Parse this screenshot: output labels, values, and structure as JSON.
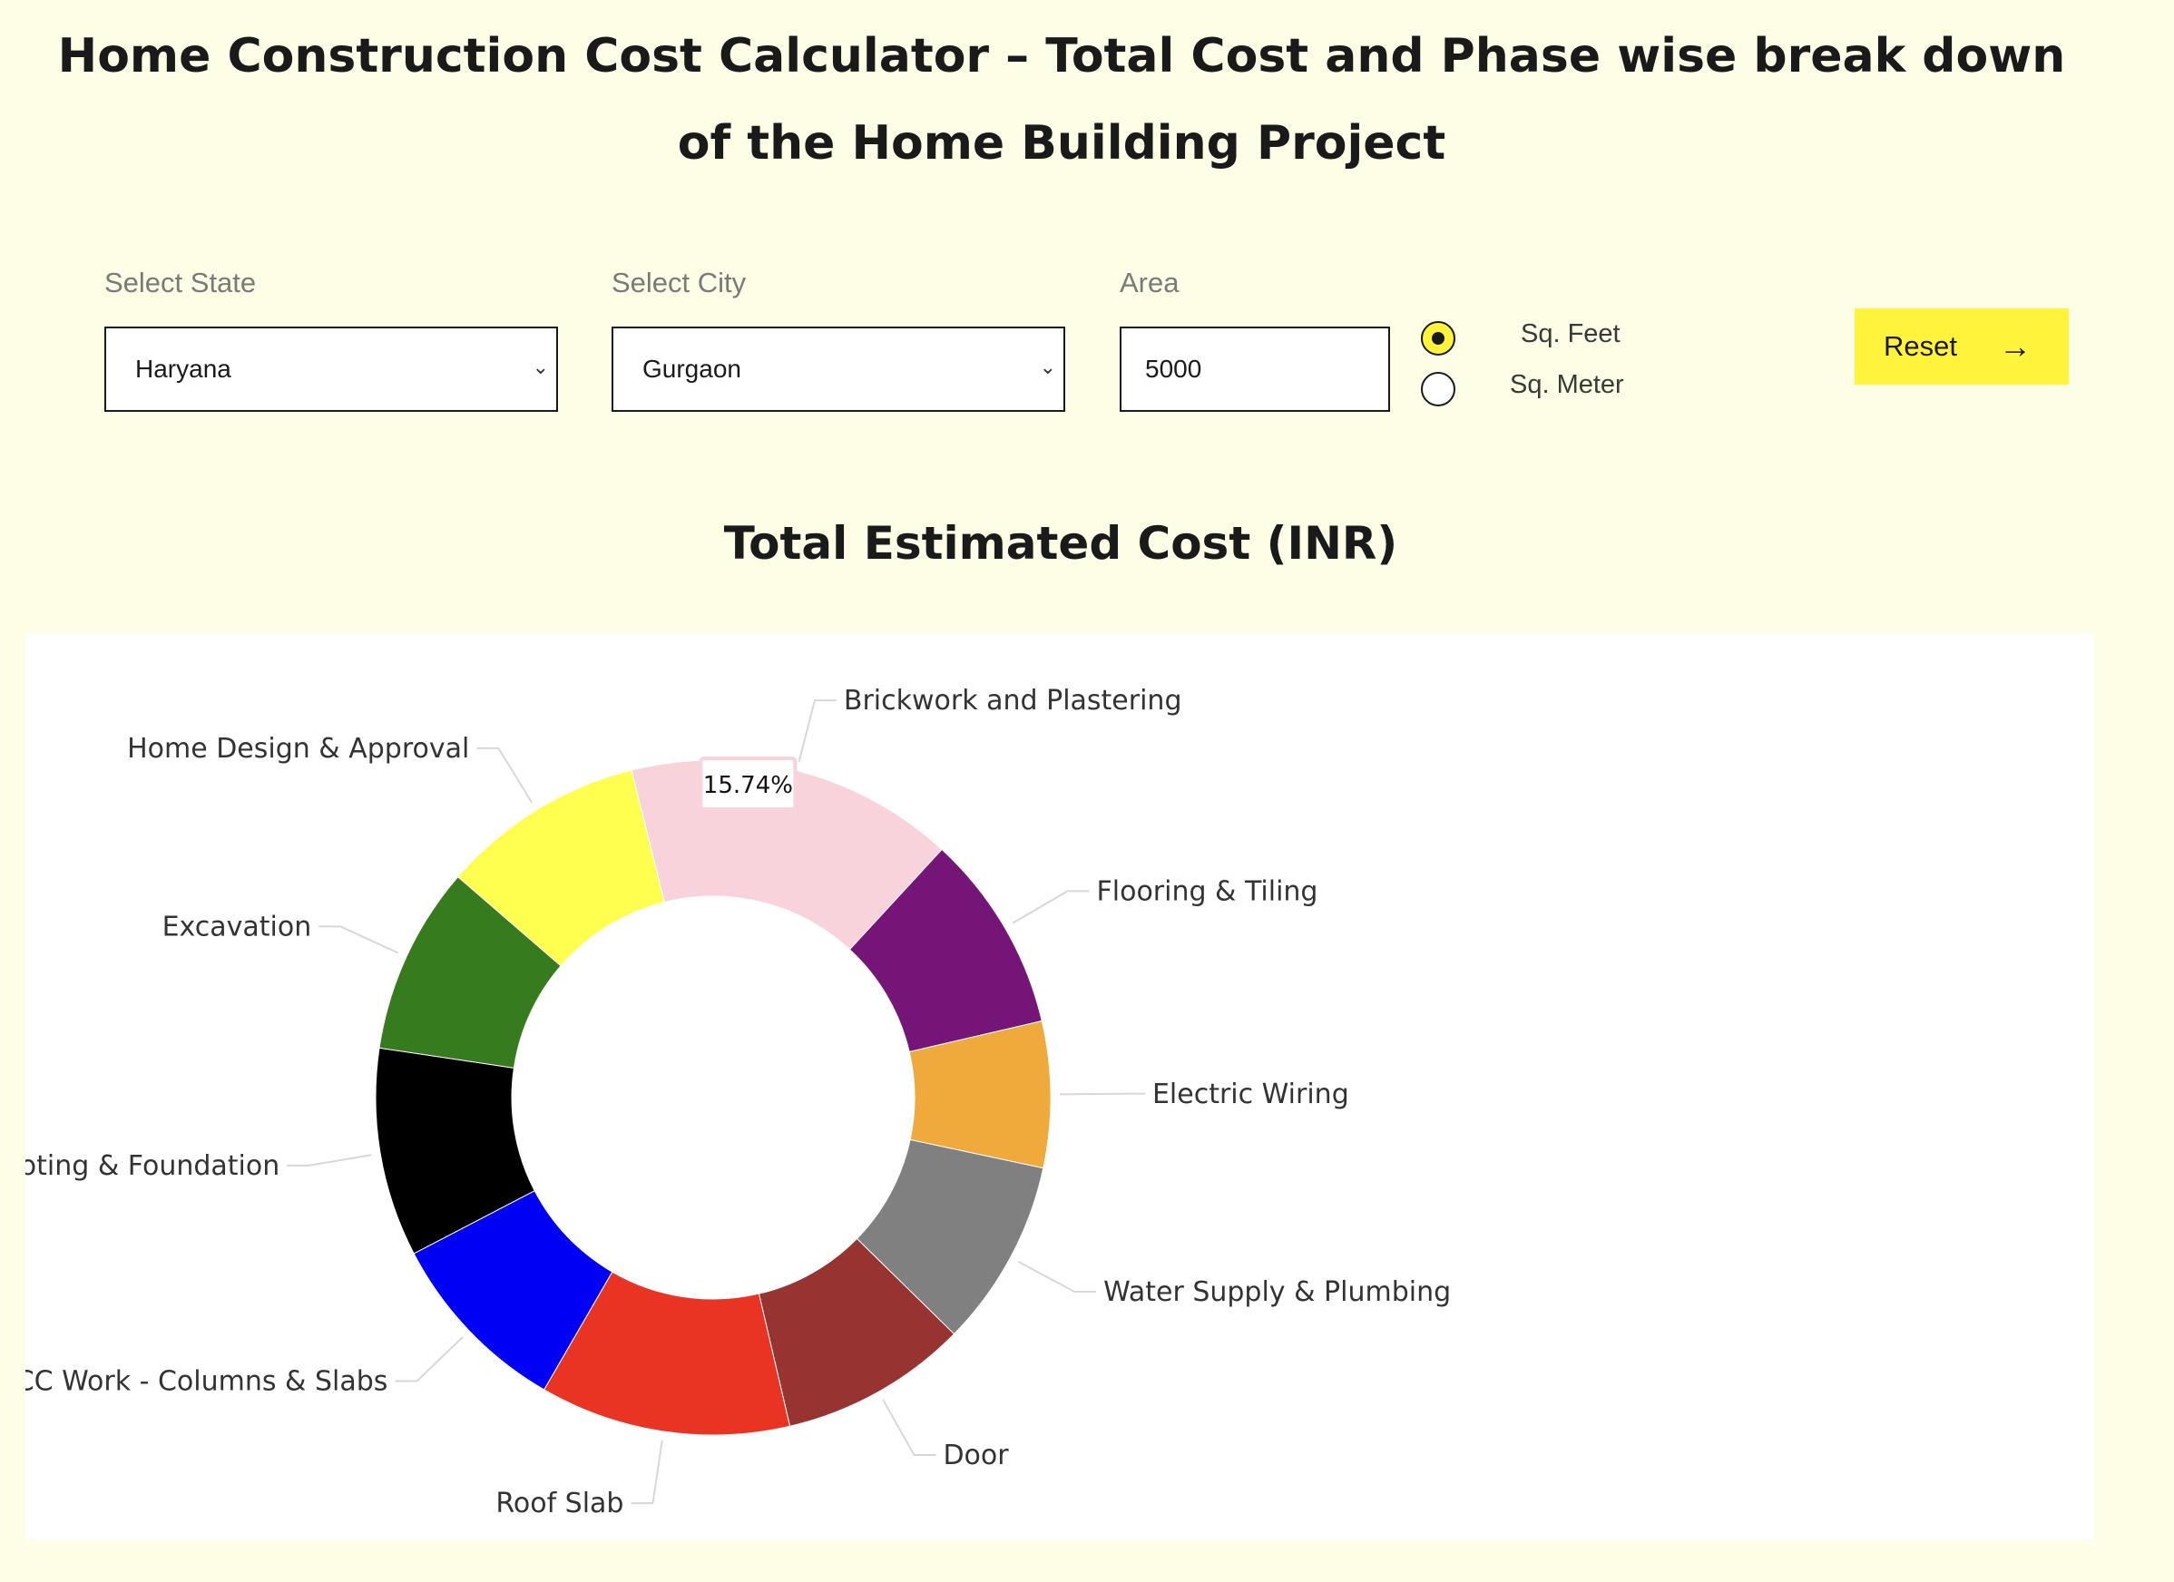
{
  "page": {
    "title": "Home Construction Cost Calculator – Total Cost and Phase wise break down of the Home Building Project"
  },
  "form": {
    "state_label": "Select State",
    "state_value": "Haryana",
    "city_label": "Select City",
    "city_value": "Gurgaon",
    "area_label": "Area",
    "area_value": "5000",
    "unit_options": [
      {
        "label": "Sq. Feet",
        "checked": true
      },
      {
        "label": "Sq. Meter",
        "checked": false
      }
    ],
    "reset_label": "Reset",
    "reset_arrow": "→"
  },
  "chart_title": "Total Estimated Cost (INR)",
  "chart_data": {
    "type": "pie",
    "donut": true,
    "title": "Total Estimated Cost (INR)",
    "tooltip": {
      "category": "Brickwork and Plastering",
      "text": "15.74%"
    },
    "slices": [
      {
        "label": "Brickwork and Plastering",
        "value": 15.74,
        "color": "#f9d3dc"
      },
      {
        "label": "Flooring & Tiling",
        "value": 9.5,
        "color": "#751577"
      },
      {
        "label": "Electric Wiring",
        "value": 7.0,
        "color": "#f0a93b"
      },
      {
        "label": "Water Supply & Plumbing",
        "value": 9.0,
        "color": "#808080"
      },
      {
        "label": "Door",
        "value": 9.0,
        "color": "#973330"
      },
      {
        "label": "Roof Slab",
        "value": 12.0,
        "color": "#e93323"
      },
      {
        "label": "RCC Work - Columns & Slabs",
        "value": 9.0,
        "color": "#0000f5"
      },
      {
        "label": "Footing & Foundation",
        "value": 10.0,
        "color": "#000000"
      },
      {
        "label": "Excavation",
        "value": 9.0,
        "color": "#377b1f"
      },
      {
        "label": "Home Design & Approval",
        "value": 9.76,
        "color": "#ffff50"
      }
    ]
  }
}
